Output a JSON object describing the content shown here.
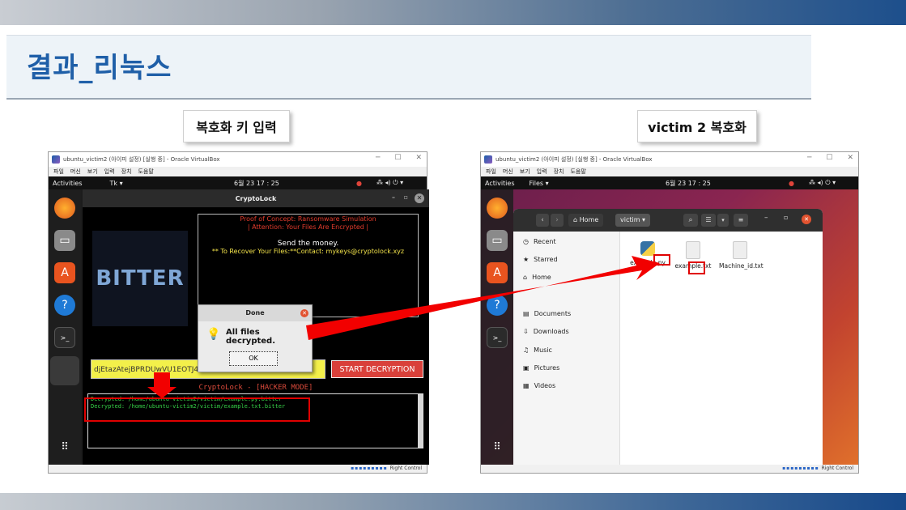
{
  "slide": {
    "title": "결과_리눅스",
    "left_caption": "복호화 키 입력",
    "right_caption": "victim 2 복호화"
  },
  "vm_left": {
    "window_title": "ubuntu_victim2 (아이피 설정) [실행 중] - Oracle VirtualBox",
    "menu": [
      "파일",
      "머신",
      "보기",
      "입력",
      "장치",
      "도움말"
    ],
    "activities": "Activities",
    "app_menu": "Tk ▾",
    "clock": "6월 23  17 : 25",
    "status_right": "Right Control",
    "app": {
      "title": "CryptoLock",
      "logo_text": "BITTER",
      "message_lines": [
        {
          "text": "Proof of Concept: Ransomware Simulation",
          "color": "#e23b2c"
        },
        {
          "text": "| Attention: Your Files Are Encrypted |",
          "color": "#e23b2c"
        },
        {
          "text": "Send the money.",
          "color": "#ffffff"
        },
        {
          "text": "** To Recover Your Files:**Contact: mykeys@cryptolock.xyz",
          "color": "#f2e24a"
        }
      ],
      "key_value": "djEtazAtejBPRDUwVU1EOTJ4",
      "start_button": "START DECRYPTION",
      "mode_label": "CryptoLock - [HACKER MODE]",
      "log_lines": [
        "Decrypted: /home/ubuntu-victim2/victim/example.py.bitter",
        "Decrypted: /home/ubuntu-victim2/victim/example.txt.bitter"
      ],
      "dialog": {
        "title": "Done",
        "message": "All files decrypted.",
        "ok": "OK"
      }
    }
  },
  "vm_right": {
    "window_title": "ubuntu_victim2 (아이피 설정) [실행 중] - Oracle VirtualBox",
    "menu": [
      "파일",
      "머신",
      "보기",
      "입력",
      "장치",
      "도움말"
    ],
    "activities": "Activities",
    "app_menu": "Files ▾",
    "clock": "6월 23  17 : 25",
    "status_right": "Right Control",
    "files": {
      "breadcrumb_home": "Home",
      "breadcrumb_folder": "victim",
      "sidebar": [
        "Recent",
        "Starred",
        "Home",
        "Documents",
        "Downloads",
        "Music",
        "Pictures",
        "Videos"
      ],
      "items": [
        {
          "name": "example.py",
          "type": "python"
        },
        {
          "name": "example.txt",
          "type": "text"
        },
        {
          "name": "Machine_id.txt",
          "type": "text"
        }
      ]
    }
  },
  "colors": {
    "title_blue": "#1f5fa8",
    "highlight_red": "#e00000",
    "arrow_red": "#f20000"
  }
}
